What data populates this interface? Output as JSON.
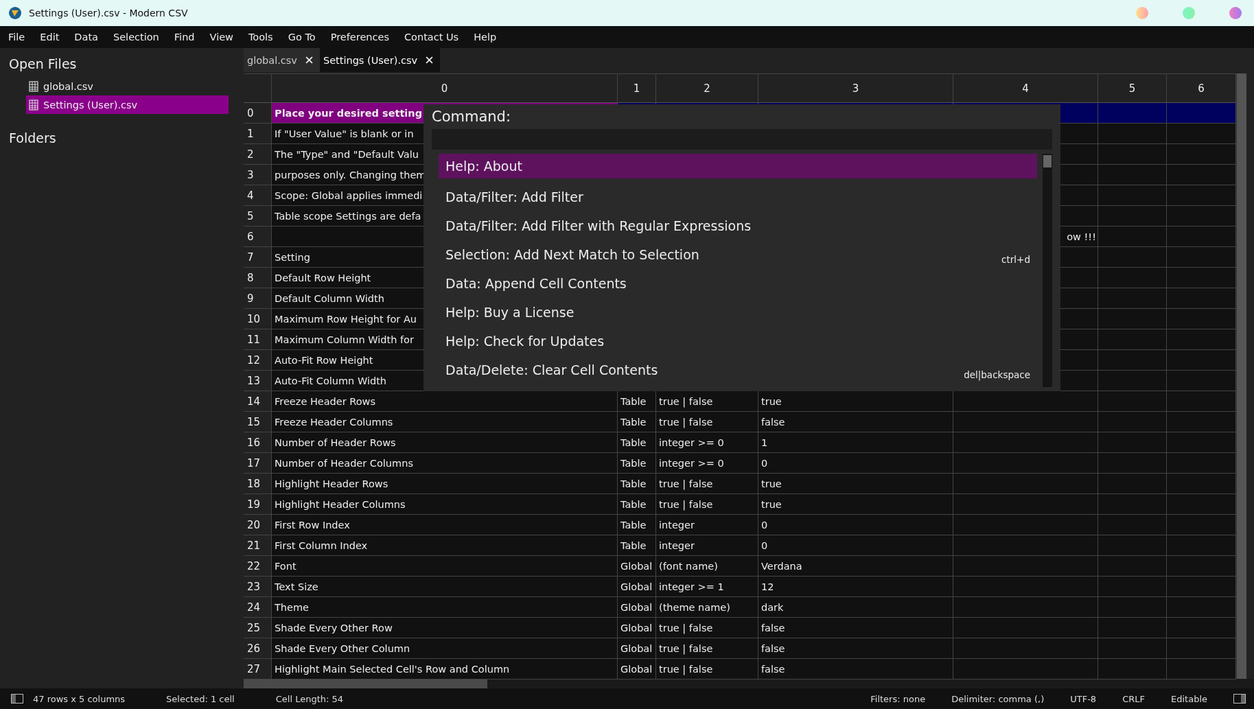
{
  "window": {
    "title": "Settings (User).csv - Modern CSV"
  },
  "menu": [
    "File",
    "Edit",
    "Data",
    "Selection",
    "Find",
    "View",
    "Tools",
    "Go To",
    "Preferences",
    "Contact Us",
    "Help"
  ],
  "sidebar": {
    "open_files_heading": "Open Files",
    "files": [
      {
        "label": "global.csv",
        "selected": false
      },
      {
        "label": "Settings (User).csv",
        "selected": true
      }
    ],
    "folders_heading": "Folders"
  },
  "tabs": [
    {
      "label": "global.csv",
      "selected": false
    },
    {
      "label": "Settings (User).csv",
      "selected": true
    }
  ],
  "table": {
    "columns": [
      "0",
      "1",
      "2",
      "3",
      "4",
      "5",
      "6"
    ],
    "rows": [
      {
        "n": "0",
        "selected": true,
        "column_0": "Place your desired setting"
      },
      {
        "n": "1",
        "selected": false,
        "column_0": "If \"User Value\" is blank or in"
      },
      {
        "n": "2",
        "selected": false,
        "column_0": "The \"Type\" and \"Default Valu"
      },
      {
        "n": "3",
        "selected": false,
        "column_0": "purposes only. Changing them"
      },
      {
        "n": "4",
        "selected": false,
        "column_0": "Scope: Global applies immedi"
      },
      {
        "n": "5",
        "selected": false,
        "column_0": "Table scope Settings are defa"
      },
      {
        "n": "6",
        "selected": false,
        "column_4": "ow !!!"
      },
      {
        "n": "7",
        "selected": false,
        "column_0": "Setting"
      },
      {
        "n": "8",
        "selected": false,
        "column_0": "Default Row Height"
      },
      {
        "n": "9",
        "selected": false,
        "column_0": "Default Column Width"
      },
      {
        "n": "10",
        "selected": false,
        "column_0": "Maximum Row Height for Au"
      },
      {
        "n": "11",
        "selected": false,
        "column_0": "Maximum Column Width for"
      },
      {
        "n": "12",
        "selected": false,
        "column_0": "Auto-Fit Row Height"
      },
      {
        "n": "13",
        "selected": false,
        "column_0": "Auto-Fit Column Width"
      },
      {
        "n": "14",
        "selected": false,
        "column_0": "Freeze Header Rows",
        "column_1": "Table",
        "column_2": "true | false",
        "column_3": "true"
      },
      {
        "n": "15",
        "selected": false,
        "column_0": "Freeze Header Columns",
        "column_1": "Table",
        "column_2": "true | false",
        "column_3": "false"
      },
      {
        "n": "16",
        "selected": false,
        "column_0": "Number of Header Rows",
        "column_1": "Table",
        "column_2": "integer >= 0",
        "column_3": "1"
      },
      {
        "n": "17",
        "selected": false,
        "column_0": "Number of Header Columns",
        "column_1": "Table",
        "column_2": "integer >= 0",
        "column_3": "0"
      },
      {
        "n": "18",
        "selected": false,
        "column_0": "Highlight Header Rows",
        "column_1": "Table",
        "column_2": "true | false",
        "column_3": "true"
      },
      {
        "n": "19",
        "selected": false,
        "column_0": "Highlight Header Columns",
        "column_1": "Table",
        "column_2": "true | false",
        "column_3": "true"
      },
      {
        "n": "20",
        "selected": false,
        "column_0": "First Row Index",
        "column_1": "Table",
        "column_2": "integer",
        "column_3": "0"
      },
      {
        "n": "21",
        "selected": false,
        "column_0": "First Column Index",
        "column_1": "Table",
        "column_2": "integer",
        "column_3": "0"
      },
      {
        "n": "22",
        "selected": false,
        "column_0": "Font",
        "column_1": "Global",
        "column_2": "(font name)",
        "column_3": "Verdana"
      },
      {
        "n": "23",
        "selected": false,
        "column_0": "Text Size",
        "column_1": "Global",
        "column_2": "integer >= 1",
        "column_3": "12"
      },
      {
        "n": "24",
        "selected": false,
        "column_0": "Theme",
        "column_1": "Global",
        "column_2": "(theme name)",
        "column_3": "dark"
      },
      {
        "n": "25",
        "selected": false,
        "column_0": "Shade Every Other Row",
        "column_1": "Global",
        "column_2": "true | false",
        "column_3": "false"
      },
      {
        "n": "26",
        "selected": false,
        "column_0": "Shade Every Other Column",
        "column_1": "Global",
        "column_2": "true | false",
        "column_3": "false"
      },
      {
        "n": "27",
        "selected": false,
        "column_0": "Highlight Main Selected Cell's Row and Column",
        "column_1": "Global",
        "column_2": "true | false",
        "column_3": "false"
      }
    ]
  },
  "command_palette": {
    "label": "Command:",
    "items": [
      {
        "label": "Help: About",
        "selected": true
      },
      {
        "label": "Data/Filter: Add Filter",
        "selected": false
      },
      {
        "label": "Data/Filter: Add Filter with Regular Expressions",
        "selected": false
      },
      {
        "label": "Selection: Add Next Match to Selection",
        "shortcut": "ctrl+d",
        "selected": false
      },
      {
        "label": "Data: Append Cell Contents",
        "selected": false
      },
      {
        "label": "Help: Buy a License",
        "selected": false
      },
      {
        "label": "Help: Check for Updates",
        "selected": false
      },
      {
        "label": "Data/Delete: Clear Cell Contents",
        "shortcut": "del|backspace",
        "selected": false
      }
    ]
  },
  "status_bar": {
    "left": [
      "47 rows x 5 columns",
      "Selected: 1 cell",
      "Cell Length: 54"
    ],
    "right": [
      "Filters: none",
      "Delimiter: comma (,)",
      "UTF-8",
      "CRLF",
      "Editable"
    ]
  }
}
